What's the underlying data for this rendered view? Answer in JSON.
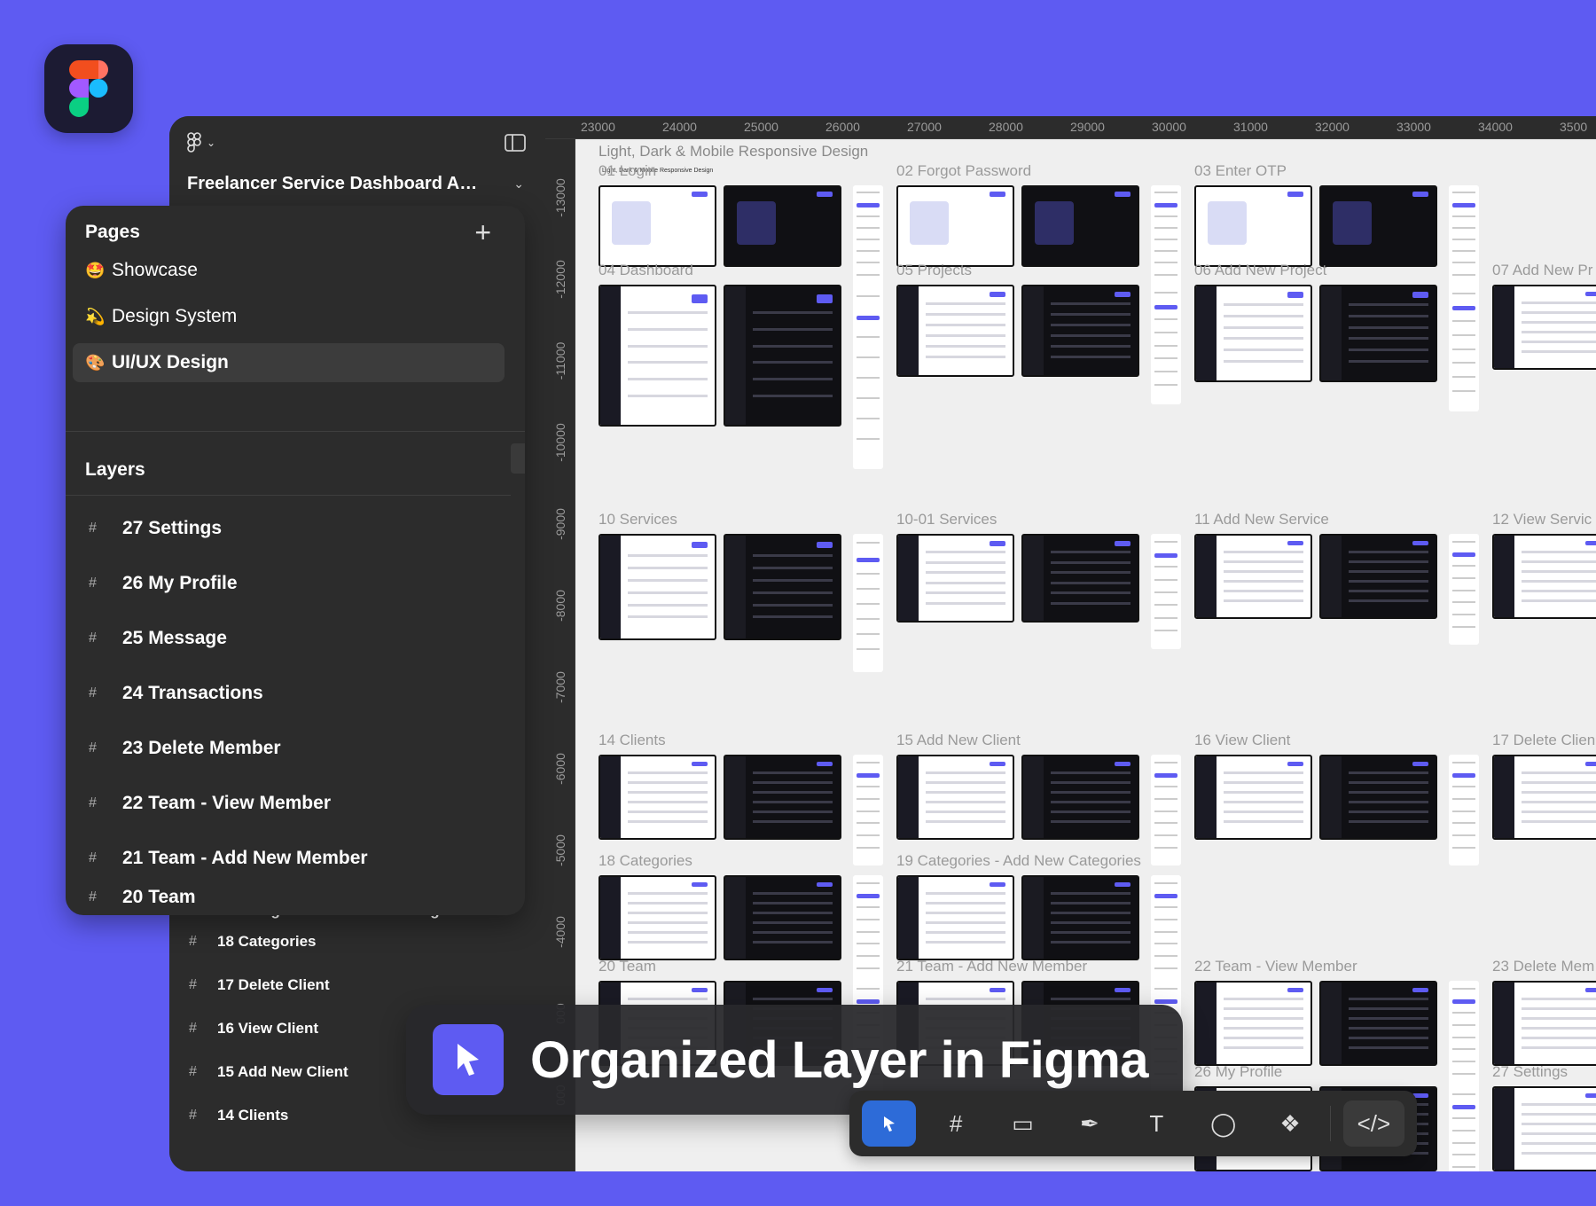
{
  "file": {
    "title": "Freelancer Service Dashboard Ad..."
  },
  "pages_panel": {
    "header": "Pages",
    "add_icon": "plus-icon",
    "pages": [
      {
        "emoji": "🤩",
        "label": "Showcase"
      },
      {
        "emoji": "💫",
        "label": "Design System"
      },
      {
        "emoji": "🎨",
        "label": "UI/UX Design",
        "active": true
      }
    ]
  },
  "layers_panel": {
    "header": "Layers",
    "items": [
      "27 Settings",
      "26 My Profile",
      "25 Message",
      "24 Transactions",
      "23 Delete Member",
      "22 Team - View Member",
      "21 Team - Add New Member",
      "20 Team"
    ]
  },
  "back_layers": {
    "cut_item": "19 Categories - Add New Categories",
    "items": [
      "18 Categories",
      "17 Delete Client",
      "16 View Client",
      "15 Add New Client",
      "14 Clients"
    ]
  },
  "ruler": {
    "top": [
      "23000",
      "24000",
      "25000",
      "26000",
      "27000",
      "28000",
      "29000",
      "30000",
      "31000",
      "32000",
      "33000",
      "34000",
      "3500"
    ],
    "left": [
      "-13000",
      "-12000",
      "-11000",
      "-10000",
      "-9000",
      "-8000",
      "-7000",
      "-6000",
      "-5000",
      "-4000",
      "000",
      "000"
    ]
  },
  "canvas": {
    "heading": "Light, Dark & Mobile Responsive Design",
    "subnote": "Light, Dark & Mobile Responsive Design",
    "sections": [
      "01 Login",
      "02 Forgot Password",
      "03 Enter OTP",
      "04 Dashboard",
      "05 Projects",
      "06 Add New Project",
      "07 Add New Pr",
      "10 Services",
      "10-01 Services",
      "11 Add New Service",
      "12 View Servic",
      "14 Clients",
      "15 Add New Client",
      "16 View Client",
      "17 Delete Clien",
      "18 Categories",
      "19 Categories - Add New Categories",
      "20 Team",
      "21 Team - Add New Member",
      "22 Team - View Member",
      "23 Delete Mem",
      "26 My Profile",
      "27 Settings"
    ]
  },
  "caption": {
    "text": "Organized Layer in Figma",
    "icon": "cursor-arrow-icon"
  },
  "toolbar": {
    "tools": [
      "move-tool-icon",
      "frame-tool-icon",
      "rectangle-tool-icon",
      "pen-tool-icon",
      "text-tool-icon",
      "comment-tool-icon",
      "components-tool-icon"
    ],
    "dev_mode_icon": "code-icon",
    "active_tool": "move-tool-icon"
  },
  "colors": {
    "brand_purple": "#5e5bf2",
    "panel_bg": "#2c2c2c",
    "canvas_bg": "#efefef",
    "active_tool": "#2d6bd8"
  }
}
